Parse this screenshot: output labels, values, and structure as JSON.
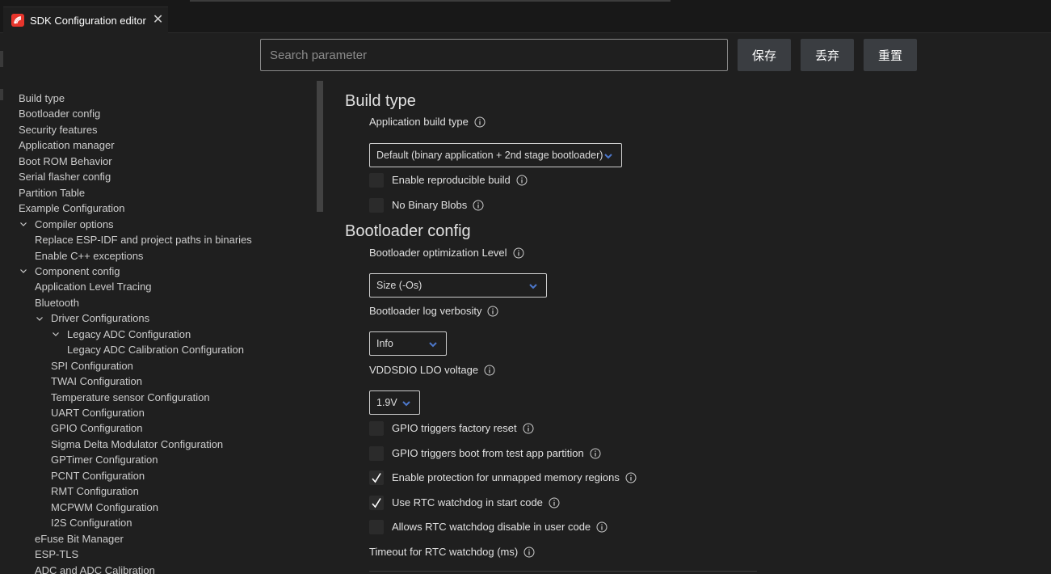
{
  "tab": {
    "title": "SDK Configuration editor",
    "icon": "espressif-logo-icon",
    "close": "✕"
  },
  "search": {
    "placeholder": "Search parameter",
    "value": ""
  },
  "buttons": {
    "save": "保存",
    "discard": "丢弃",
    "reset": "重置"
  },
  "colors": {
    "accent_caret": "#4d78cc",
    "background": "#1f1f1f",
    "button": "#3a3d41"
  },
  "sidebar": {
    "items": [
      {
        "label": "Build type",
        "level": 0,
        "expanded": null
      },
      {
        "label": "Bootloader config",
        "level": 0,
        "expanded": null
      },
      {
        "label": "Security features",
        "level": 0,
        "expanded": null
      },
      {
        "label": "Application manager",
        "level": 0,
        "expanded": null
      },
      {
        "label": "Boot ROM Behavior",
        "level": 0,
        "expanded": null
      },
      {
        "label": "Serial flasher config",
        "level": 0,
        "expanded": null
      },
      {
        "label": "Partition Table",
        "level": 0,
        "expanded": null
      },
      {
        "label": "Example Configuration",
        "level": 0,
        "expanded": null
      },
      {
        "label": "Compiler options",
        "level": 0,
        "expanded": true
      },
      {
        "label": "Replace ESP-IDF and project paths in binaries",
        "level": 1,
        "expanded": null
      },
      {
        "label": "Enable C++ exceptions",
        "level": 1,
        "expanded": null
      },
      {
        "label": "Component config",
        "level": 0,
        "expanded": true
      },
      {
        "label": "Application Level Tracing",
        "level": 1,
        "expanded": null
      },
      {
        "label": "Bluetooth",
        "level": 1,
        "expanded": null
      },
      {
        "label": "Driver Configurations",
        "level": 1,
        "expanded": true
      },
      {
        "label": "Legacy ADC Configuration",
        "level": 2,
        "expanded": true
      },
      {
        "label": "Legacy ADC Calibration Configuration",
        "level": 3,
        "expanded": null
      },
      {
        "label": "SPI Configuration",
        "level": 2,
        "expanded": null
      },
      {
        "label": "TWAI Configuration",
        "level": 2,
        "expanded": null
      },
      {
        "label": "Temperature sensor Configuration",
        "level": 2,
        "expanded": null
      },
      {
        "label": "UART Configuration",
        "level": 2,
        "expanded": null
      },
      {
        "label": "GPIO Configuration",
        "level": 2,
        "expanded": null
      },
      {
        "label": "Sigma Delta Modulator Configuration",
        "level": 2,
        "expanded": null
      },
      {
        "label": "GPTimer Configuration",
        "level": 2,
        "expanded": null
      },
      {
        "label": "PCNT Configuration",
        "level": 2,
        "expanded": null
      },
      {
        "label": "RMT Configuration",
        "level": 2,
        "expanded": null
      },
      {
        "label": "MCPWM Configuration",
        "level": 2,
        "expanded": null
      },
      {
        "label": "I2S Configuration",
        "level": 2,
        "expanded": null
      },
      {
        "label": "eFuse Bit Manager",
        "level": 1,
        "expanded": null
      },
      {
        "label": "ESP-TLS",
        "level": 1,
        "expanded": null
      },
      {
        "label": "ADC and ADC Calibration",
        "level": 1,
        "expanded": null
      }
    ]
  },
  "main": {
    "build_type": {
      "title": "Build type",
      "app_build_type_label": "Application build type",
      "app_build_type_value": "Default (binary application + 2nd stage bootloader)",
      "reproducible_label": "Enable reproducible build",
      "reproducible_checked": false,
      "no_blobs_label": "No Binary Blobs",
      "no_blobs_checked": false
    },
    "bootloader": {
      "title": "Bootloader config",
      "opt_level_label": "Bootloader optimization Level",
      "opt_level_value": "Size (-Os)",
      "log_label": "Bootloader log verbosity",
      "log_value": "Info",
      "ldo_label": "VDDSDIO LDO voltage",
      "ldo_value": "1.9V",
      "gpio_reset_label": "GPIO triggers factory reset",
      "gpio_reset_checked": false,
      "gpio_boot_label": "GPIO triggers boot from test app partition",
      "gpio_boot_checked": false,
      "unmapped_label": "Enable protection for unmapped memory regions",
      "unmapped_checked": true,
      "rtc_wdt_label": "Use RTC watchdog in start code",
      "rtc_wdt_checked": true,
      "rtc_wdt_disable_label": "Allows RTC watchdog disable in user code",
      "rtc_wdt_disable_checked": false,
      "rtc_timeout_label": "Timeout for RTC watchdog (ms)"
    }
  }
}
